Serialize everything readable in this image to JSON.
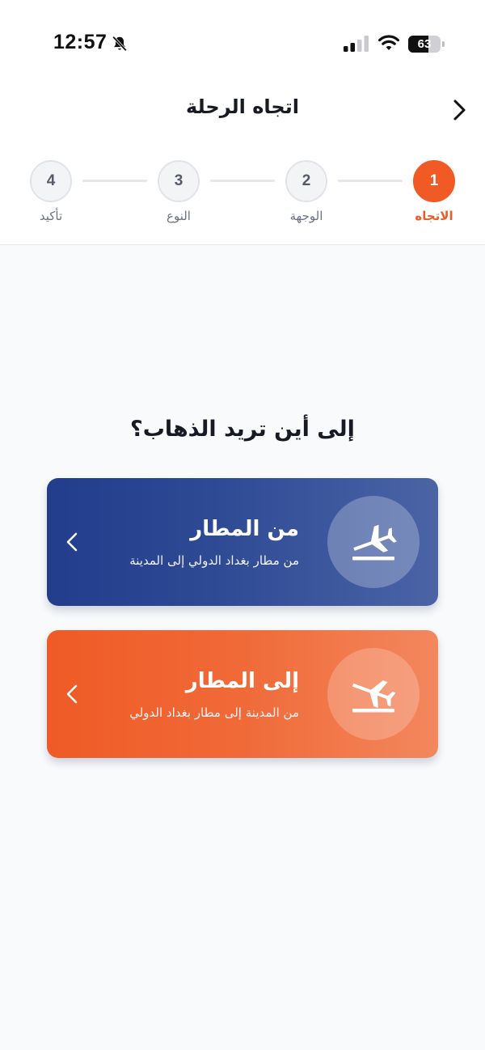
{
  "status_bar": {
    "time": "12:57",
    "battery_level": "63",
    "icons": [
      "bell-slash-icon",
      "cellular-signal-icon",
      "wifi-icon",
      "battery-icon"
    ]
  },
  "header": {
    "title": "اتجاه الرحلة",
    "back_icon": "chevron-right-icon"
  },
  "stepper": {
    "steps": [
      {
        "number": "1",
        "label": "الاتجاه",
        "active": true
      },
      {
        "number": "2",
        "label": "الوجهة",
        "active": false
      },
      {
        "number": "3",
        "label": "النوع",
        "active": false
      },
      {
        "number": "4",
        "label": "تأكيد",
        "active": false
      }
    ]
  },
  "main": {
    "question": "إلى أين تريد الذهاب؟",
    "options": [
      {
        "title": "من المطار",
        "subtitle": "من مطار بغداد الدولي إلى المدينة",
        "icon": "plane-departure-icon",
        "chevron": "chevron-left-icon"
      },
      {
        "title": "إلى المطار",
        "subtitle": "من المدينة إلى مطار بغداد الدولي",
        "icon": "plane-arrival-icon",
        "chevron": "chevron-left-icon"
      }
    ]
  },
  "colors": {
    "accent": "#f05a24",
    "from_card": "#2a438f",
    "to_card": "#f06a38",
    "background": "#f8fafc"
  }
}
